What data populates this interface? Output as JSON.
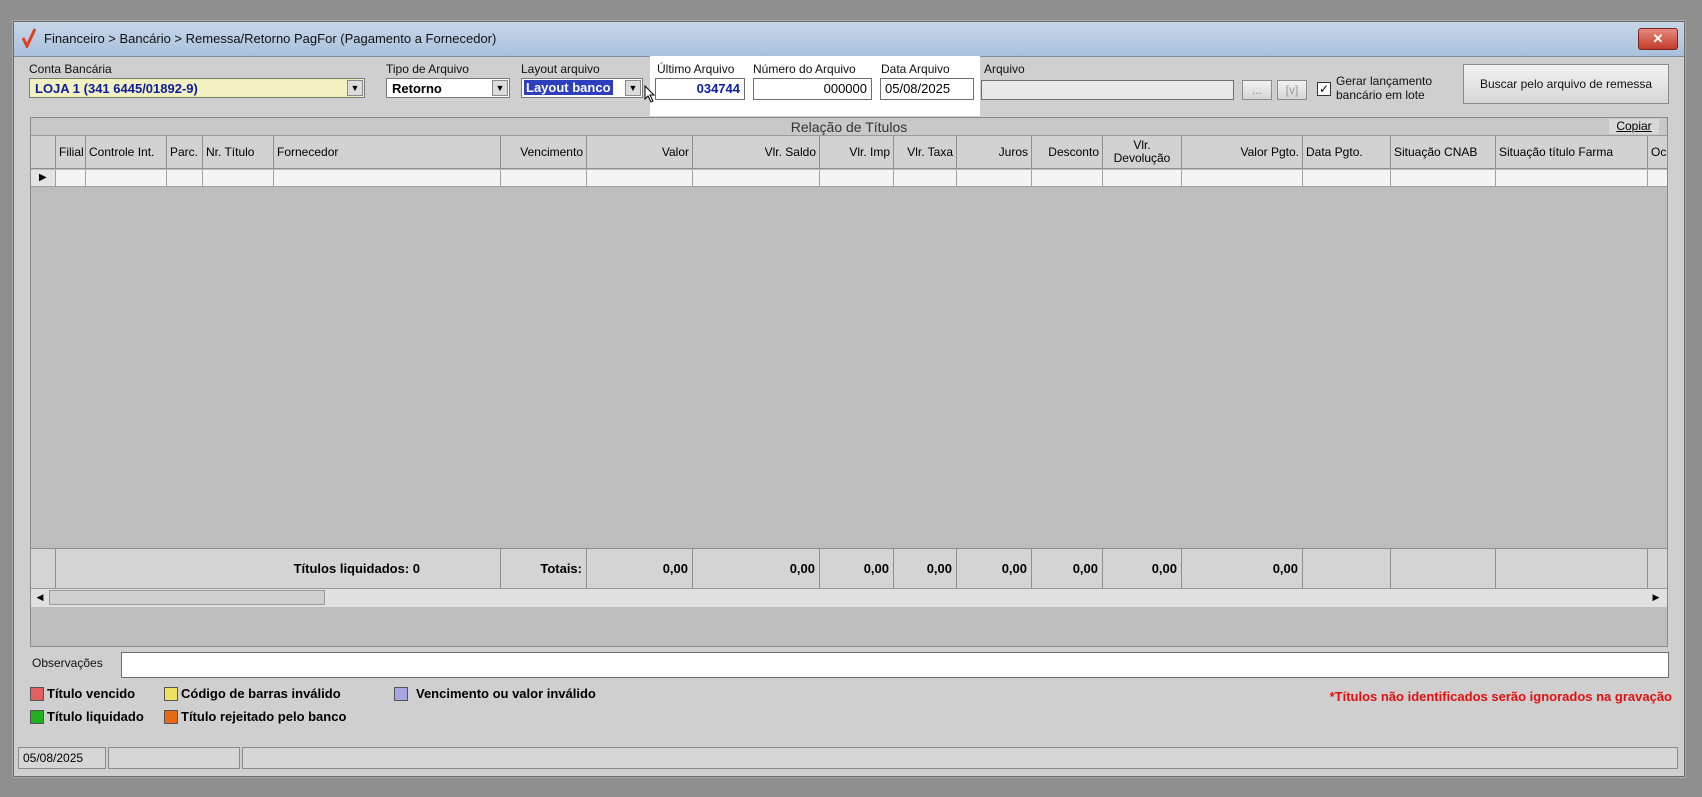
{
  "window": {
    "title": "Financeiro > Bancário > Remessa/Retorno PagFor (Pagamento  a Fornecedor)",
    "close_label": "✕"
  },
  "filters": {
    "conta_bancaria_label": "Conta Bancária",
    "conta_bancaria_value": "LOJA 1 (341 6445/01892-9)",
    "tipo_arquivo_label": "Tipo de Arquivo",
    "tipo_arquivo_value": "Retorno",
    "layout_arquivo_label": "Layout arquivo",
    "layout_arquivo_value": "Layout banco",
    "ultimo_arquivo_label": "Último Arquivo",
    "ultimo_arquivo_value": "034744",
    "numero_arquivo_label": "Número do Arquivo",
    "numero_arquivo_value": "000000",
    "data_arquivo_label": "Data Arquivo",
    "data_arquivo_value": "05/08/2025",
    "arquivo_label": "Arquivo",
    "arquivo_value": "",
    "browse_label": "...",
    "view_label": "[v]",
    "gerar_lote_label_1": "Gerar lançamento",
    "gerar_lote_label_2": "bancário em lote",
    "gerar_lote_checked": true,
    "buscar_label": "Buscar pelo arquivo de remessa"
  },
  "grid": {
    "caption": "Relação de Títulos",
    "copy_label": "Copiar",
    "columns": [
      "Filial",
      "Controle Int.",
      "Parc.",
      "Nr. Título",
      "Fornecedor",
      "Vencimento",
      "Valor",
      "Vlr. Saldo",
      "Vlr. Imp",
      "Vlr. Taxa",
      "Juros",
      "Desconto",
      "Vlr.\nDevolução",
      "Valor Pgto.",
      "Data Pgto.",
      "Situação CNAB",
      "Situação título Farma",
      "Oc"
    ],
    "footer": {
      "titulos_liquidados": "Títulos liquidados: 0",
      "totais": "Totais:",
      "valor": "0,00",
      "vlr_saldo": "0,00",
      "vlr_imp": "0,00",
      "vlr_taxa": "0,00",
      "juros": "0,00",
      "desconto": "0,00",
      "vlr_devolucao": "0,00",
      "valor_pgto": "0,00"
    }
  },
  "observacoes": {
    "label": "Observações",
    "value": ""
  },
  "legend": {
    "vencido": {
      "label": "Título vencido",
      "color": "#e06060"
    },
    "codigo_barras": {
      "label": "Código de barras inválido",
      "color": "#f0e060"
    },
    "vencimento_valor": {
      "label": "Vencimento ou valor inválido",
      "color": "#a6a6e0"
    },
    "liquidado": {
      "label": "Título liquidado",
      "color": "#20b020"
    },
    "rejeitado": {
      "label": "Título rejeitado pelo banco",
      "color": "#e86a10"
    }
  },
  "warning": "*Títulos não identificados serão ignorados na gravação",
  "statusbar": {
    "date": "05/08/2025"
  }
}
